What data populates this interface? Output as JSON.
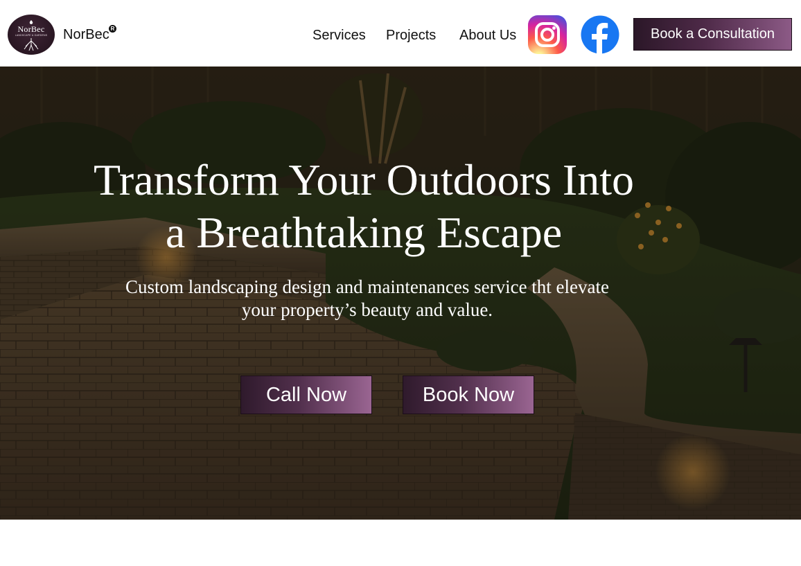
{
  "header": {
    "logo": {
      "word": "NorBec",
      "sub": "LANDSCAPE & GARDENS",
      "icon": "logo-tree-roots"
    },
    "brand": "NorBec",
    "brand_mark": "R",
    "nav": [
      {
        "label": "Services"
      },
      {
        "label": "Projects"
      },
      {
        "label": "About Us"
      }
    ],
    "social": [
      {
        "icon": "instagram-icon"
      },
      {
        "icon": "facebook-icon"
      }
    ],
    "consult_label": "Book a Consultation"
  },
  "hero": {
    "title_line1": "Transform Your Outdoors Into",
    "title_line2": "a Breathtaking Escape",
    "subtitle_line1": "Custom landscaping design and maintenances service tht elevate",
    "subtitle_line2": "your property’s beauty and value.",
    "call_label": "Call Now",
    "book_label": "Book Now"
  },
  "colors": {
    "accent_dark": "#2b1728",
    "accent_light": "#8c5a86",
    "facebook": "#1877f2",
    "hero_overlay": "#1a140d"
  }
}
